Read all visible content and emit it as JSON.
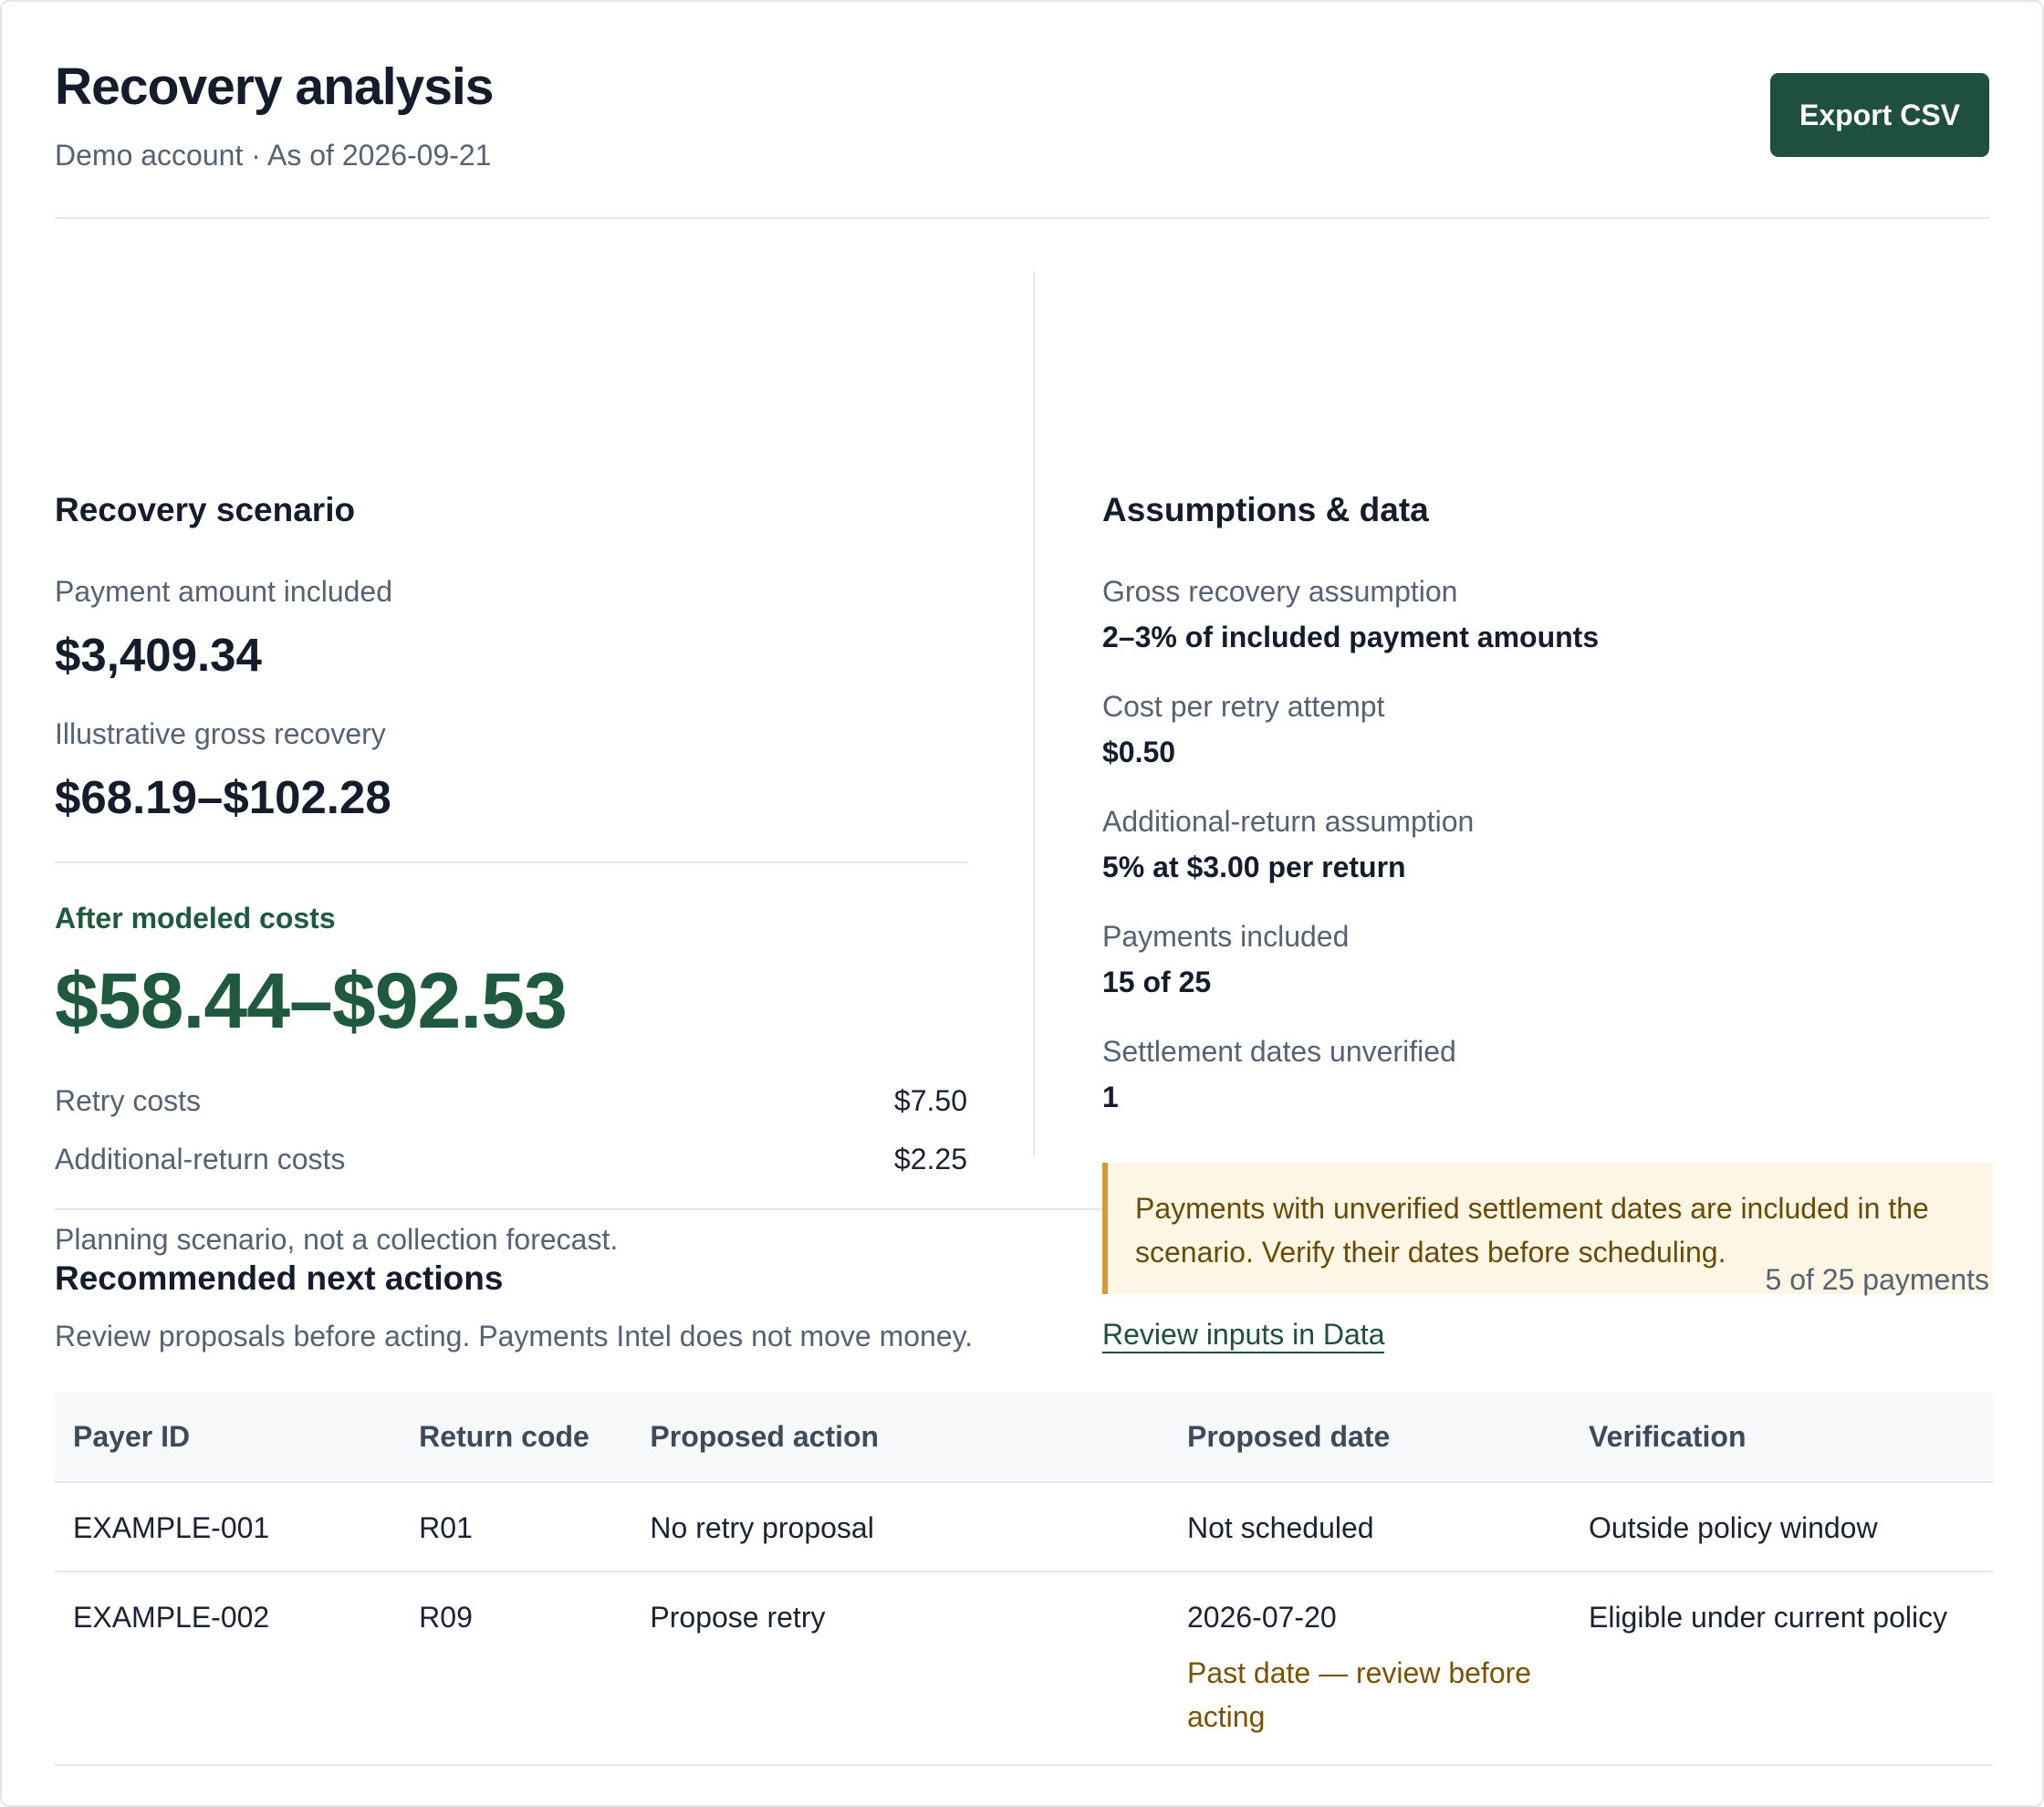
{
  "header": {
    "title": "Recovery analysis",
    "subtitle": "Demo account · As of 2026-09-21",
    "export_label": "Export CSV"
  },
  "scenario": {
    "title": "Recovery scenario",
    "payment_amount_label": "Payment amount included",
    "payment_amount_value": "$3,409.34",
    "gross_recovery_label": "Illustrative gross recovery",
    "gross_recovery_value": "$68.19–$102.28",
    "after_costs_label": "After modeled costs",
    "after_costs_value": "$58.44–$92.53",
    "costs": [
      {
        "label": "Retry costs",
        "value": "$7.50"
      },
      {
        "label": "Additional-return costs",
        "value": "$2.25"
      }
    ],
    "note": "Planning scenario, not a collection forecast."
  },
  "assumptions": {
    "title": "Assumptions & data",
    "items": [
      {
        "label": "Gross recovery assumption",
        "value": "2–3% of included payment amounts"
      },
      {
        "label": "Cost per retry attempt",
        "value": "$0.50"
      },
      {
        "label": "Additional-return assumption",
        "value": "5% at $3.00 per return"
      },
      {
        "label": "Payments included",
        "value": "15 of 25"
      },
      {
        "label": "Settlement dates unverified",
        "value": "1"
      }
    ],
    "warning": "Payments with unverified settlement dates are included in the scenario. Verify their dates before scheduling.",
    "review_link": "Review inputs in Data"
  },
  "actions": {
    "title": "Recommended next actions",
    "count": "5 of 25 payments",
    "description": "Review proposals before acting. Payments Intel does not move money.",
    "columns": [
      "Payer ID",
      "Return code",
      "Proposed action",
      "Proposed date",
      "Verification"
    ],
    "rows": [
      {
        "payer": "EXAMPLE-001",
        "code": "R01",
        "action": "No retry proposal",
        "date": "Not scheduled",
        "date_note": "",
        "verification": "Outside policy window"
      },
      {
        "payer": "EXAMPLE-002",
        "code": "R09",
        "action": "Propose retry",
        "date": "2026-07-20",
        "date_note": "Past date — review before acting",
        "verification": "Eligible under current policy"
      }
    ]
  },
  "colors": {
    "brand": "#1f4f3d",
    "accent_text": "#1f5a40",
    "warning_bg": "#fef6e4",
    "warning_border": "#d39a3a",
    "warning_text": "#7a5200"
  }
}
